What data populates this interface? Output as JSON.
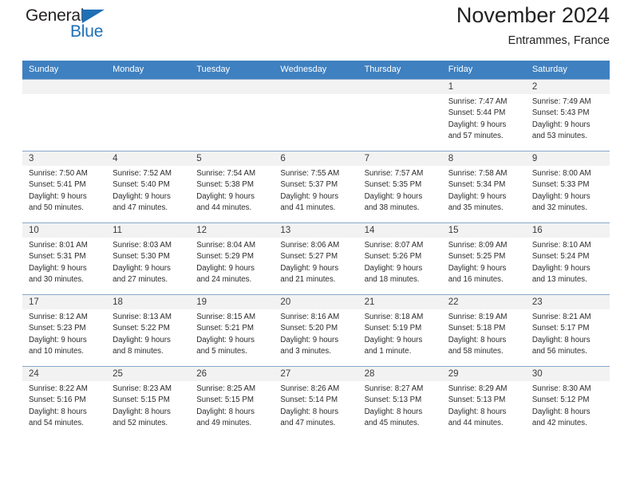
{
  "logo": {
    "word_one": "General",
    "word_two": "Blue",
    "triangle_color": "#1f6fb6"
  },
  "header": {
    "title": "November 2024",
    "subtitle": "Entrammes, France",
    "header_bg": "#3f80c0",
    "daynum_bg": "#f2f2f2"
  },
  "weekdays": [
    "Sunday",
    "Monday",
    "Tuesday",
    "Wednesday",
    "Thursday",
    "Friday",
    "Saturday"
  ],
  "weeks": [
    [
      {
        "day": "",
        "empty": true
      },
      {
        "day": "",
        "empty": true
      },
      {
        "day": "",
        "empty": true
      },
      {
        "day": "",
        "empty": true
      },
      {
        "day": "",
        "empty": true
      },
      {
        "day": "1",
        "sunrise": "Sunrise: 7:47 AM",
        "sunset": "Sunset: 5:44 PM",
        "daylight1": "Daylight: 9 hours",
        "daylight2": "and 57 minutes."
      },
      {
        "day": "2",
        "sunrise": "Sunrise: 7:49 AM",
        "sunset": "Sunset: 5:43 PM",
        "daylight1": "Daylight: 9 hours",
        "daylight2": "and 53 minutes."
      }
    ],
    [
      {
        "day": "3",
        "sunrise": "Sunrise: 7:50 AM",
        "sunset": "Sunset: 5:41 PM",
        "daylight1": "Daylight: 9 hours",
        "daylight2": "and 50 minutes."
      },
      {
        "day": "4",
        "sunrise": "Sunrise: 7:52 AM",
        "sunset": "Sunset: 5:40 PM",
        "daylight1": "Daylight: 9 hours",
        "daylight2": "and 47 minutes."
      },
      {
        "day": "5",
        "sunrise": "Sunrise: 7:54 AM",
        "sunset": "Sunset: 5:38 PM",
        "daylight1": "Daylight: 9 hours",
        "daylight2": "and 44 minutes."
      },
      {
        "day": "6",
        "sunrise": "Sunrise: 7:55 AM",
        "sunset": "Sunset: 5:37 PM",
        "daylight1": "Daylight: 9 hours",
        "daylight2": "and 41 minutes."
      },
      {
        "day": "7",
        "sunrise": "Sunrise: 7:57 AM",
        "sunset": "Sunset: 5:35 PM",
        "daylight1": "Daylight: 9 hours",
        "daylight2": "and 38 minutes."
      },
      {
        "day": "8",
        "sunrise": "Sunrise: 7:58 AM",
        "sunset": "Sunset: 5:34 PM",
        "daylight1": "Daylight: 9 hours",
        "daylight2": "and 35 minutes."
      },
      {
        "day": "9",
        "sunrise": "Sunrise: 8:00 AM",
        "sunset": "Sunset: 5:33 PM",
        "daylight1": "Daylight: 9 hours",
        "daylight2": "and 32 minutes."
      }
    ],
    [
      {
        "day": "10",
        "sunrise": "Sunrise: 8:01 AM",
        "sunset": "Sunset: 5:31 PM",
        "daylight1": "Daylight: 9 hours",
        "daylight2": "and 30 minutes."
      },
      {
        "day": "11",
        "sunrise": "Sunrise: 8:03 AM",
        "sunset": "Sunset: 5:30 PM",
        "daylight1": "Daylight: 9 hours",
        "daylight2": "and 27 minutes."
      },
      {
        "day": "12",
        "sunrise": "Sunrise: 8:04 AM",
        "sunset": "Sunset: 5:29 PM",
        "daylight1": "Daylight: 9 hours",
        "daylight2": "and 24 minutes."
      },
      {
        "day": "13",
        "sunrise": "Sunrise: 8:06 AM",
        "sunset": "Sunset: 5:27 PM",
        "daylight1": "Daylight: 9 hours",
        "daylight2": "and 21 minutes."
      },
      {
        "day": "14",
        "sunrise": "Sunrise: 8:07 AM",
        "sunset": "Sunset: 5:26 PM",
        "daylight1": "Daylight: 9 hours",
        "daylight2": "and 18 minutes."
      },
      {
        "day": "15",
        "sunrise": "Sunrise: 8:09 AM",
        "sunset": "Sunset: 5:25 PM",
        "daylight1": "Daylight: 9 hours",
        "daylight2": "and 16 minutes."
      },
      {
        "day": "16",
        "sunrise": "Sunrise: 8:10 AM",
        "sunset": "Sunset: 5:24 PM",
        "daylight1": "Daylight: 9 hours",
        "daylight2": "and 13 minutes."
      }
    ],
    [
      {
        "day": "17",
        "sunrise": "Sunrise: 8:12 AM",
        "sunset": "Sunset: 5:23 PM",
        "daylight1": "Daylight: 9 hours",
        "daylight2": "and 10 minutes."
      },
      {
        "day": "18",
        "sunrise": "Sunrise: 8:13 AM",
        "sunset": "Sunset: 5:22 PM",
        "daylight1": "Daylight: 9 hours",
        "daylight2": "and 8 minutes."
      },
      {
        "day": "19",
        "sunrise": "Sunrise: 8:15 AM",
        "sunset": "Sunset: 5:21 PM",
        "daylight1": "Daylight: 9 hours",
        "daylight2": "and 5 minutes."
      },
      {
        "day": "20",
        "sunrise": "Sunrise: 8:16 AM",
        "sunset": "Sunset: 5:20 PM",
        "daylight1": "Daylight: 9 hours",
        "daylight2": "and 3 minutes."
      },
      {
        "day": "21",
        "sunrise": "Sunrise: 8:18 AM",
        "sunset": "Sunset: 5:19 PM",
        "daylight1": "Daylight: 9 hours",
        "daylight2": "and 1 minute."
      },
      {
        "day": "22",
        "sunrise": "Sunrise: 8:19 AM",
        "sunset": "Sunset: 5:18 PM",
        "daylight1": "Daylight: 8 hours",
        "daylight2": "and 58 minutes."
      },
      {
        "day": "23",
        "sunrise": "Sunrise: 8:21 AM",
        "sunset": "Sunset: 5:17 PM",
        "daylight1": "Daylight: 8 hours",
        "daylight2": "and 56 minutes."
      }
    ],
    [
      {
        "day": "24",
        "sunrise": "Sunrise: 8:22 AM",
        "sunset": "Sunset: 5:16 PM",
        "daylight1": "Daylight: 8 hours",
        "daylight2": "and 54 minutes."
      },
      {
        "day": "25",
        "sunrise": "Sunrise: 8:23 AM",
        "sunset": "Sunset: 5:15 PM",
        "daylight1": "Daylight: 8 hours",
        "daylight2": "and 52 minutes."
      },
      {
        "day": "26",
        "sunrise": "Sunrise: 8:25 AM",
        "sunset": "Sunset: 5:15 PM",
        "daylight1": "Daylight: 8 hours",
        "daylight2": "and 49 minutes."
      },
      {
        "day": "27",
        "sunrise": "Sunrise: 8:26 AM",
        "sunset": "Sunset: 5:14 PM",
        "daylight1": "Daylight: 8 hours",
        "daylight2": "and 47 minutes."
      },
      {
        "day": "28",
        "sunrise": "Sunrise: 8:27 AM",
        "sunset": "Sunset: 5:13 PM",
        "daylight1": "Daylight: 8 hours",
        "daylight2": "and 45 minutes."
      },
      {
        "day": "29",
        "sunrise": "Sunrise: 8:29 AM",
        "sunset": "Sunset: 5:13 PM",
        "daylight1": "Daylight: 8 hours",
        "daylight2": "and 44 minutes."
      },
      {
        "day": "30",
        "sunrise": "Sunrise: 8:30 AM",
        "sunset": "Sunset: 5:12 PM",
        "daylight1": "Daylight: 8 hours",
        "daylight2": "and 42 minutes."
      }
    ]
  ]
}
